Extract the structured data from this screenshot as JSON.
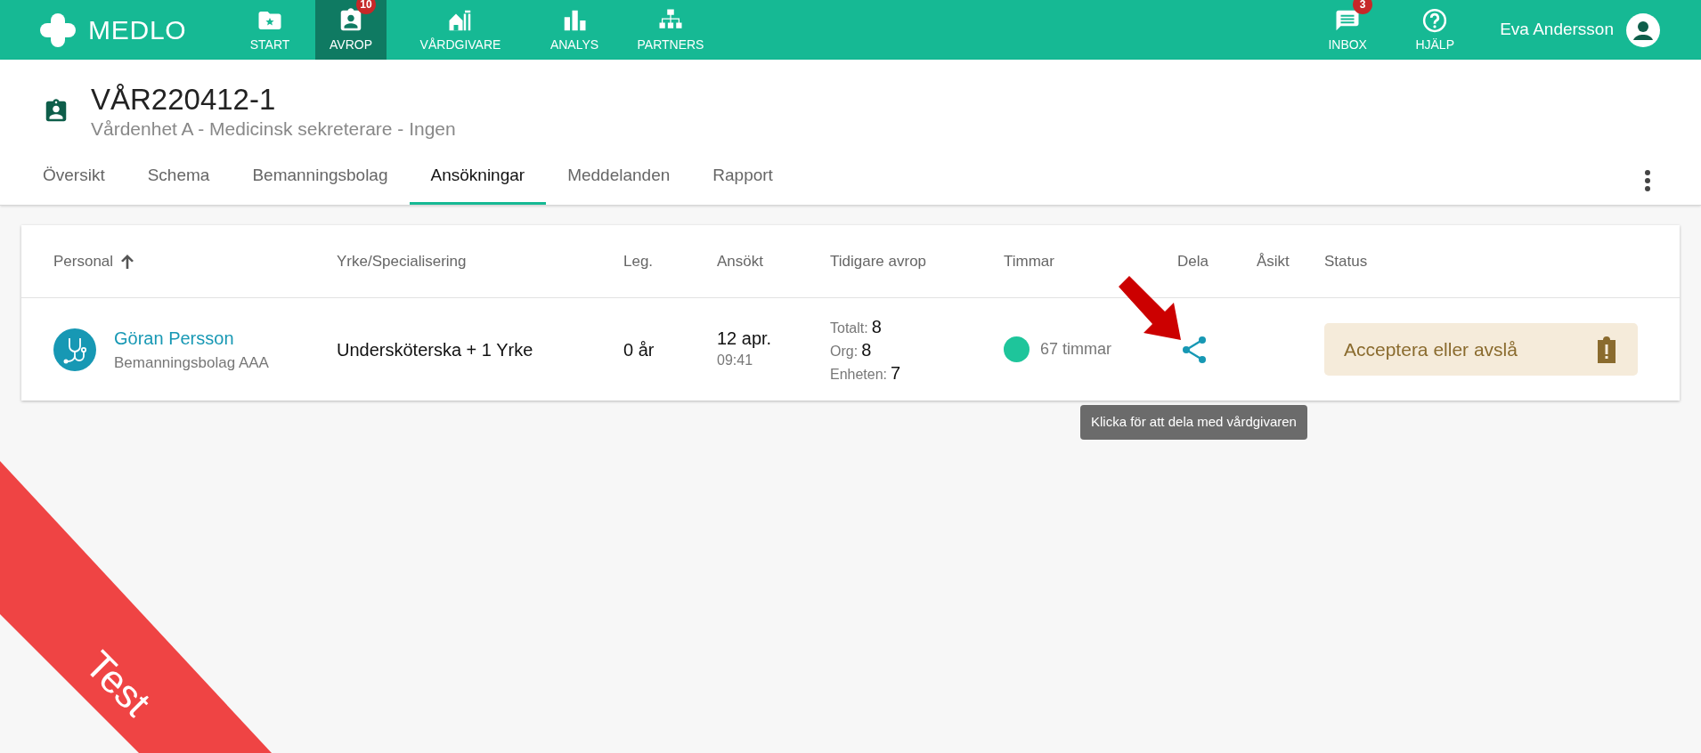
{
  "app": {
    "name": "MEDLO"
  },
  "nav": [
    {
      "label": "START",
      "selected": false
    },
    {
      "label": "AVROP",
      "selected": true,
      "badge": "10"
    },
    {
      "label": "VÅRDGIVARE",
      "selected": false
    },
    {
      "label": "ANALYS",
      "selected": false
    },
    {
      "label": "PARTNERS",
      "selected": false
    }
  ],
  "nav_right": [
    {
      "label": "INBOX",
      "badge": "3"
    },
    {
      "label": "HJÄLP"
    }
  ],
  "user": {
    "name": "Eva Andersson"
  },
  "page": {
    "title": "VÅR220412-1",
    "subtitle": "Vårdenhet A - Medicinsk sekreterare - Ingen"
  },
  "tabs": [
    {
      "label": "Översikt",
      "selected": false
    },
    {
      "label": "Schema",
      "selected": false
    },
    {
      "label": "Bemanningsbolag",
      "selected": false
    },
    {
      "label": "Ansökningar",
      "selected": true
    },
    {
      "label": "Meddelanden",
      "selected": false
    },
    {
      "label": "Rapport",
      "selected": false
    }
  ],
  "table": {
    "columns": [
      {
        "label": "Personal",
        "sort_ascending": true
      },
      {
        "label": "Yrke/Specialisering"
      },
      {
        "label": "Leg."
      },
      {
        "label": "Ansökt"
      },
      {
        "label": "Tidigare avrop"
      },
      {
        "label": "Timmar"
      },
      {
        "label": "Dela"
      },
      {
        "label": "Åsikt"
      },
      {
        "label": "Status"
      }
    ],
    "rows": [
      {
        "name": "Göran Persson",
        "company": "Bemanningsbolag AAA",
        "profession": "Undersköterska + 1 Yrke",
        "leg": "0 år",
        "date": "12 apr.",
        "time": "09:41",
        "previous": [
          {
            "label": "Totalt:",
            "value": "8"
          },
          {
            "label": "Org:",
            "value": "8"
          },
          {
            "label": "Enheten:",
            "value": "7"
          }
        ],
        "color": "#1ec59b",
        "hours": "67 timmar",
        "status": "Acceptera eller avslå"
      }
    ]
  },
  "tooltip": "Klicka för att dela med vårdgivaren",
  "ribbon": {
    "label": "Test"
  }
}
